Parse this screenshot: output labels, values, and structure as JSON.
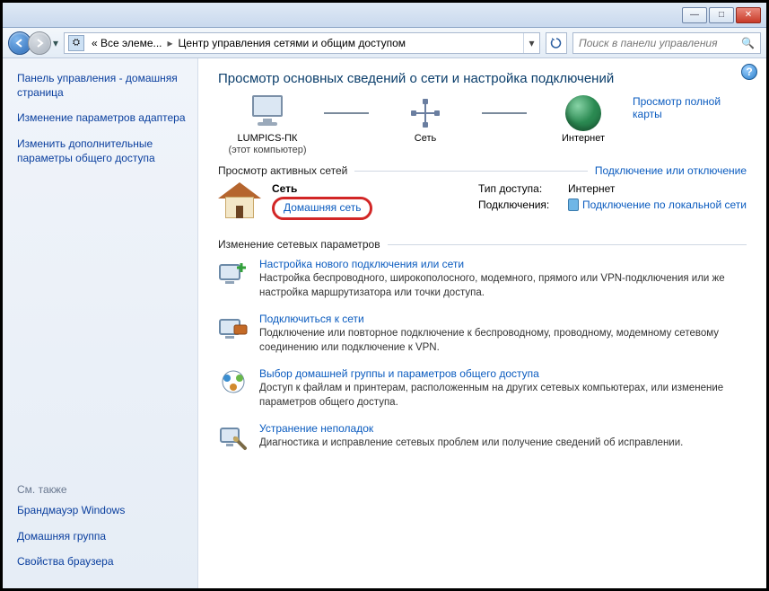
{
  "window": {
    "close": "✕",
    "maximize": "□",
    "minimize": "—"
  },
  "nav": {
    "breadcrumb_prefix": "« Все элеме...",
    "breadcrumb_current": "Центр управления сетями и общим доступом",
    "search_placeholder": "Поиск в панели управления"
  },
  "sidebar": {
    "top": [
      "Панель управления - домашняя страница",
      "Изменение параметров адаптера",
      "Изменить дополнительные параметры общего доступа"
    ],
    "see_also_title": "См. также",
    "bottom": [
      "Брандмауэр Windows",
      "Домашняя группа",
      "Свойства браузера"
    ]
  },
  "content": {
    "heading": "Просмотр основных сведений о сети и настройка подключений",
    "full_map_link": "Просмотр полной карты",
    "map": {
      "pc_name": "LUMPICS-ПК",
      "pc_sub": "(этот компьютер)",
      "net_name": "Сеть",
      "internet": "Интернет"
    },
    "active_section": {
      "title": "Просмотр активных сетей",
      "right_link": "Подключение или отключение"
    },
    "active_net": {
      "name": "Сеть",
      "type_link": "Домашняя сеть",
      "access_label": "Тип доступа:",
      "access_value": "Интернет",
      "conn_label": "Подключения:",
      "conn_link": "Подключение по локальной сети"
    },
    "settings_section_title": "Изменение сетевых параметров",
    "tasks": [
      {
        "title": "Настройка нового подключения или сети",
        "desc": "Настройка беспроводного, широкополосного, модемного, прямого или VPN-подключения или же настройка маршрутизатора или точки доступа."
      },
      {
        "title": "Подключиться к сети",
        "desc": "Подключение или повторное подключение к беспроводному, проводному, модемному сетевому соединению или подключение к VPN."
      },
      {
        "title": "Выбор домашней группы и параметров общего доступа",
        "desc": "Доступ к файлам и принтерам, расположенным на других сетевых компьютерах, или изменение параметров общего доступа."
      },
      {
        "title": "Устранение неполадок",
        "desc": "Диагностика и исправление сетевых проблем или получение сведений об исправлении."
      }
    ]
  }
}
